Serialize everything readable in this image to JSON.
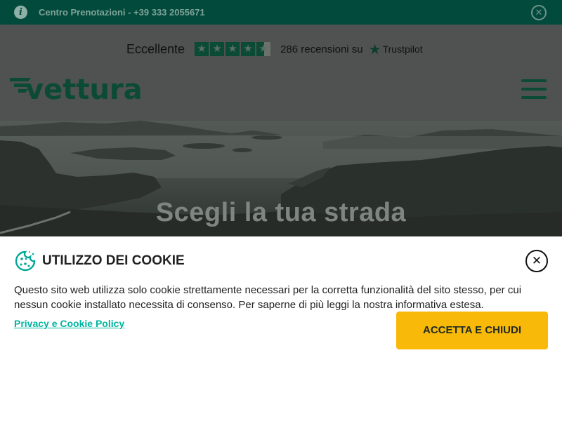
{
  "topbar": {
    "info_icon": "info-icon",
    "booking_text": "Centro Prenotazioni - +39 333 2055671",
    "close_icon": "close-icon"
  },
  "header": {
    "trustpilot": {
      "rating_label": "Eccellente",
      "stars": 4.5,
      "reviews": "286 recensioni su",
      "brand": "Trustpilot"
    },
    "logo": "vettura",
    "menu_icon": "hamburger-menu-icon"
  },
  "hero": {
    "title": "Scegli la tua strada"
  },
  "cookie": {
    "title": "UTILIZZO DEI COOKIE",
    "text": "Questo sito web utilizza solo cookie strettamente necessari per la corretta funzionalità del sito stesso, per cui nessun cookie installato necessita di consenso. Per saperne di più leggi la nostra informativa estesa.",
    "link": "Privacy e Cookie Policy",
    "accept": "ACCETTA E CHIUDI",
    "close_icon": "close-icon"
  },
  "colors": {
    "brand_green": "#0b4a35",
    "accent_teal": "#00b5a1",
    "button_yellow": "#f9b909"
  }
}
